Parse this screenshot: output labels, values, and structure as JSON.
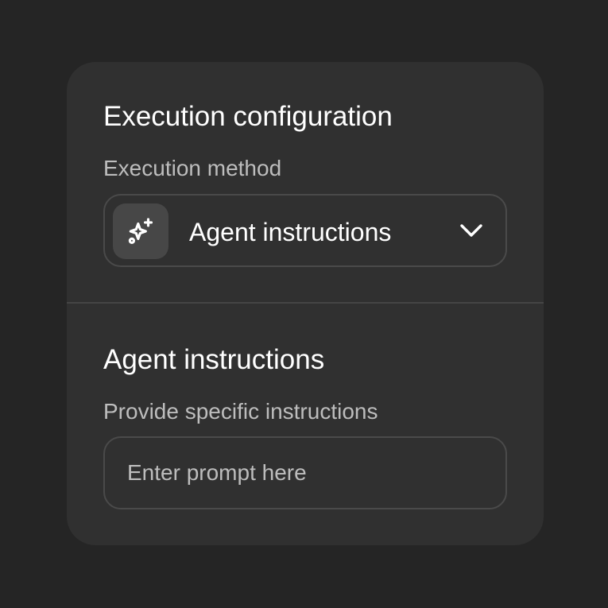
{
  "execution_config": {
    "title": "Execution configuration",
    "method_label": "Execution method",
    "method_select": {
      "icon": "sparkles-icon",
      "value": "Agent instructions"
    }
  },
  "agent_instructions": {
    "title": "Agent instructions",
    "label": "Provide specific instructions",
    "prompt_placeholder": "Enter prompt here",
    "prompt_value": ""
  },
  "colors": {
    "background": "#252525",
    "card": "#303030",
    "border": "#4a4a4a",
    "icon_box": "#474747",
    "text_primary": "#ffffff",
    "text_secondary": "#bdbdbd"
  }
}
